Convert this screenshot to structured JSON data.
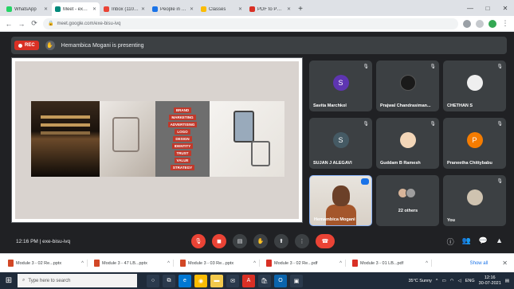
{
  "browser": {
    "tabs": [
      {
        "label": "WhatsApp",
        "color": "#25d366"
      },
      {
        "label": "Meet - exe-bisu-ivq",
        "color": "#00897b",
        "active": true
      },
      {
        "label": "Inbox (1101) - exam...",
        "color": "#ea4335"
      },
      {
        "label": "People in TUS311 2021...",
        "color": "#1a73e8"
      },
      {
        "label": "Classes",
        "color": "#fbbc04"
      },
      {
        "label": "PDF to PPT Converter...",
        "color": "#d93025"
      }
    ],
    "new_tab": "+",
    "win_min": "—",
    "win_max": "□",
    "win_close": "✕",
    "back": "←",
    "forward": "→",
    "reload": "⟳",
    "url": "meet.google.com/exe-bisu-ivq"
  },
  "meet": {
    "rec_label": "REC",
    "presenting": "Hemambica Mogani is presenting",
    "slide_words": [
      "BRAND",
      "MARKETING",
      "ADVERTISING",
      "LOGO",
      "DESIGN",
      "IDENTITY",
      "TRUST",
      "VALUE",
      "STRATEGY"
    ],
    "participants": [
      {
        "name": "Savita Marchkol",
        "initial": "S",
        "color": "#5e35b1",
        "kind": "initial"
      },
      {
        "name": "Prajwal Chandrasiman...",
        "initial": "",
        "color": "#2b2b2b",
        "kind": "photo"
      },
      {
        "name": "CHETHAN S",
        "initial": "",
        "color": "#efefef",
        "kind": "photo"
      },
      {
        "name": "SUJAN J ALEGAVI",
        "initial": "S",
        "color": "#455a64",
        "kind": "initial"
      },
      {
        "name": "Guddam B Ramesh",
        "initial": "",
        "color": "#f3d6b8",
        "kind": "photo"
      },
      {
        "name": "Praneetha Chittybabu",
        "initial": "P",
        "color": "#f57c00",
        "kind": "initial"
      },
      {
        "name": "Hemambica Mogani",
        "initial": "",
        "color": "",
        "kind": "camera"
      },
      {
        "name": "22 others",
        "initial": "",
        "color": "",
        "kind": "group"
      },
      {
        "name": "You",
        "initial": "",
        "color": "#cfc3b0",
        "kind": "photo"
      }
    ],
    "mic_icon": "🎙",
    "time_code": "12:16 PM  |  exe-bisu-ivq"
  },
  "downloads": [
    {
      "name": "Module 3 - 02 Re...pptx",
      "color": "#d24726"
    },
    {
      "name": "Module 3 - 47 LB...pptx",
      "color": "#d24726"
    },
    {
      "name": "Module 3 - 03 Re...pptx",
      "color": "#d24726"
    },
    {
      "name": "Module 3 - 02 Re...pdf",
      "color": "#d93025"
    },
    {
      "name": "Module 3 - 01 LB...pdf",
      "color": "#d93025"
    }
  ],
  "downloads_show_all": "Show all",
  "downloads_close": "✕",
  "taskbar": {
    "search_placeholder": "Type here to search",
    "weather": "35°C Sunny",
    "lang": "ENG",
    "time": "12:16",
    "date": "30-07-2021"
  }
}
